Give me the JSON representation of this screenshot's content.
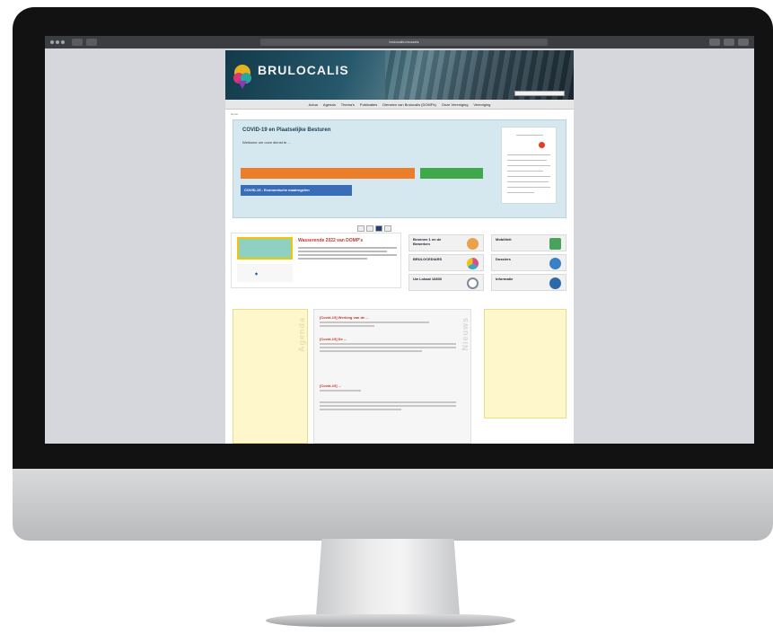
{
  "browser": {
    "url": "brulocalis.brussels"
  },
  "site": {
    "logo": "BRULOCALIS",
    "logo_sub": "",
    "top_links": "",
    "lang": ""
  },
  "nav": [
    "Actua",
    "Agenda",
    "Thema's",
    "Publicaties",
    "Diensten van Brulocalis (DOMPs)",
    "Onze Vereniging",
    "Vereniging"
  ],
  "breadcrumb": "Home",
  "covid": {
    "title": "COVID-19 en Plaatselijke Besturen",
    "line1": "Welkome om onze dienst te ...",
    "line2": "",
    "btn_orange": "",
    "btn_green": "",
    "btn_blue": "COVID-19 - Economische maatregelen"
  },
  "news_card": {
    "title": "Wasserende 2022 van DOMP's"
  },
  "tiles": [
    {
      "label": "Bronnen 1 en de Bewerken",
      "color": "#e9a14a"
    },
    {
      "label": "Mobiliteit",
      "color": "#4aa35c"
    },
    {
      "label": "BRULOCEDIARS",
      "color": "#d94f8a"
    },
    {
      "label": "Dossiers",
      "color": "#3b7fc4"
    },
    {
      "label": "Uw Lokaal 16800",
      "color": "#7c8c9c"
    },
    {
      "label": "Informatie",
      "color": "#2f6aa8"
    }
  ],
  "agenda": {
    "label": "Agenda",
    "items": [
      {
        "date": "",
        "text": ""
      },
      {
        "date": "",
        "text": ""
      },
      {
        "date": "",
        "text": ""
      },
      {
        "date": "",
        "text": ""
      },
      {
        "date": "",
        "text": ""
      }
    ]
  },
  "news": {
    "label": "Nieuws",
    "items": [
      {
        "title": "[Covid-19] Werking van de ..."
      },
      {
        "title": "[Covid-19] De ..."
      },
      {
        "title": "[Covid-19] ..."
      },
      {
        "title": ""
      }
    ]
  },
  "right_col": {
    "label": "",
    "items": [
      "",
      ""
    ],
    "link": ""
  }
}
